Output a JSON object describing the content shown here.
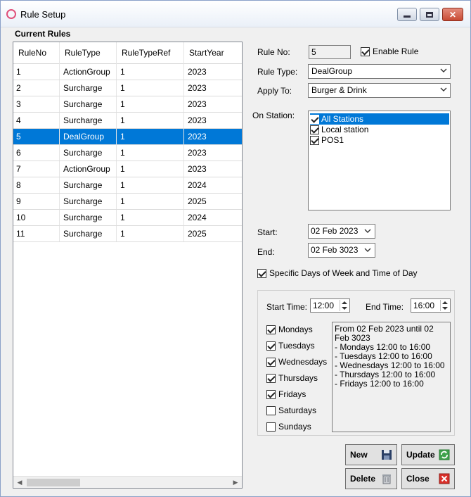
{
  "window": {
    "title": "Rule Setup"
  },
  "current_rules": {
    "title": "Current Rules",
    "columns": [
      "RuleNo",
      "RuleType",
      "RuleTypeRef",
      "StartYear"
    ],
    "rows": [
      [
        "1",
        "ActionGroup",
        "1",
        "2023"
      ],
      [
        "2",
        "Surcharge",
        "1",
        "2023"
      ],
      [
        "3",
        "Surcharge",
        "1",
        "2023"
      ],
      [
        "4",
        "Surcharge",
        "1",
        "2023"
      ],
      [
        "5",
        "DealGroup",
        "1",
        "2023"
      ],
      [
        "6",
        "Surcharge",
        "1",
        "2023"
      ],
      [
        "7",
        "ActionGroup",
        "1",
        "2023"
      ],
      [
        "8",
        "Surcharge",
        "1",
        "2024"
      ],
      [
        "9",
        "Surcharge",
        "1",
        "2025"
      ],
      [
        "10",
        "Surcharge",
        "1",
        "2024"
      ],
      [
        "11",
        "Surcharge",
        "1",
        "2025"
      ]
    ],
    "selected_row_index": 4
  },
  "rule_no": {
    "label": "Rule No:",
    "value": "5"
  },
  "enable_rule": {
    "label": "Enable Rule",
    "checked": true
  },
  "rule_type": {
    "label": "Rule Type:",
    "value": "DealGroup"
  },
  "apply_to": {
    "label": "Apply To:",
    "value": "Burger & Drink"
  },
  "on_station": {
    "label": "On  Station:",
    "items": [
      {
        "label": "All Stations",
        "checked": true,
        "selected": true
      },
      {
        "label": "Local station",
        "checked": true,
        "selected": false
      },
      {
        "label": "POS1",
        "checked": true,
        "selected": false
      }
    ]
  },
  "start": {
    "label": "Start:",
    "value": "02 Feb  2023"
  },
  "end": {
    "label": "End:",
    "value": "02 Feb  3023"
  },
  "specific_days": {
    "label": "Specific Days of Week and Time of Day",
    "checked": true
  },
  "start_time": {
    "label": "Start Time:",
    "value": "12:00"
  },
  "end_time": {
    "label": "End Time:",
    "value": "16:00"
  },
  "days": [
    {
      "label": "Mondays",
      "checked": true
    },
    {
      "label": "Tuesdays",
      "checked": true
    },
    {
      "label": "Wednesdays",
      "checked": true
    },
    {
      "label": "Thursdays",
      "checked": true
    },
    {
      "label": "Fridays",
      "checked": true
    },
    {
      "label": "Saturdays",
      "checked": false
    },
    {
      "label": "Sundays",
      "checked": false
    }
  ],
  "summary_lines": [
    "From 02 Feb 2023 until 02 Feb 3023",
    "- Mondays 12:00 to 16:00",
    "- Tuesdays 12:00 to 16:00",
    "- Wednesdays 12:00 to 16:00",
    "- Thursdays 12:00 to 16:00",
    "- Fridays 12:00 to 16:00"
  ],
  "buttons": {
    "new": "New",
    "update": "Update",
    "delete": "Delete",
    "close": "Close"
  },
  "colors": {
    "selection": "#0078d7",
    "window_bg": "#f0f0f0"
  }
}
